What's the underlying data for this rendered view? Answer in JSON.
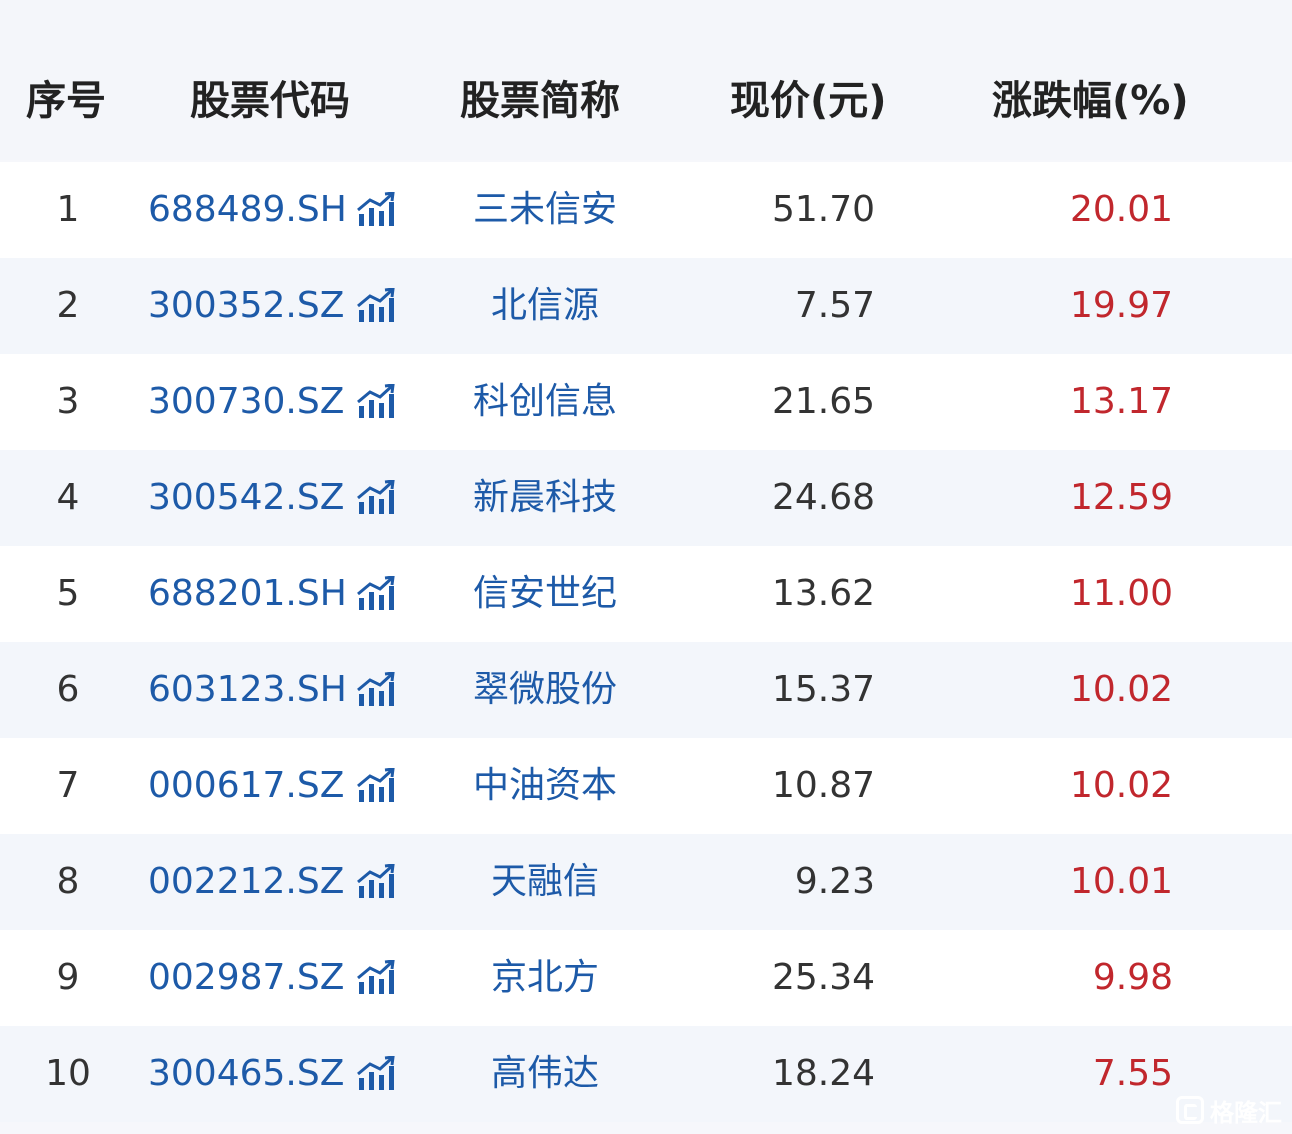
{
  "header": {
    "idx": "序号",
    "code": "股票代码",
    "name": "股票简称",
    "price": "现价(元)",
    "change": "涨跌幅(%)"
  },
  "rows": [
    {
      "idx": "1",
      "code": "688489.SH",
      "name": "三未信安",
      "price": "51.70",
      "change": "20.01"
    },
    {
      "idx": "2",
      "code": "300352.SZ",
      "name": "北信源",
      "price": "7.57",
      "change": "19.97"
    },
    {
      "idx": "3",
      "code": "300730.SZ",
      "name": "科创信息",
      "price": "21.65",
      "change": "13.17"
    },
    {
      "idx": "4",
      "code": "300542.SZ",
      "name": "新晨科技",
      "price": "24.68",
      "change": "12.59"
    },
    {
      "idx": "5",
      "code": "688201.SH",
      "name": "信安世纪",
      "price": "13.62",
      "change": "11.00"
    },
    {
      "idx": "6",
      "code": "603123.SH",
      "name": "翠微股份",
      "price": "15.37",
      "change": "10.02"
    },
    {
      "idx": "7",
      "code": "000617.SZ",
      "name": "中油资本",
      "price": "10.87",
      "change": "10.02"
    },
    {
      "idx": "8",
      "code": "002212.SZ",
      "name": "天融信",
      "price": "9.23",
      "change": "10.01"
    },
    {
      "idx": "9",
      "code": "002987.SZ",
      "name": "京北方",
      "price": "25.34",
      "change": "9.98"
    },
    {
      "idx": "10",
      "code": "300465.SZ",
      "name": "高伟达",
      "price": "18.24",
      "change": "7.55"
    }
  ],
  "icons": {
    "row_chart": "stock-chart-icon",
    "watermark_logo": "gelonghui-logo-icon"
  },
  "colors": {
    "code": "#1d5aa8",
    "name": "#1d5aa8",
    "change_up": "#c1272d",
    "header_text": "#222222"
  },
  "watermark": {
    "text": "格隆汇"
  }
}
